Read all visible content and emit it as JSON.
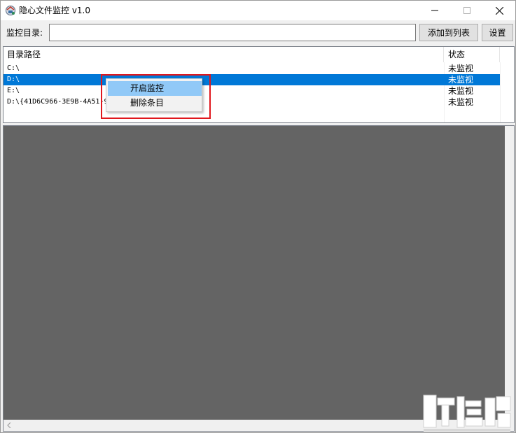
{
  "window": {
    "title": "隐心文件监控 v1.0"
  },
  "toolbar": {
    "dir_label": "监控目录:",
    "dir_value": "",
    "add_button": "添加到列表",
    "settings_button": "设置"
  },
  "list": {
    "columns": {
      "path": "目录路径",
      "status": "状态"
    },
    "rows": [
      {
        "path": "C:\\",
        "status": "未监视",
        "selected": false
      },
      {
        "path": "D:\\",
        "status": "未监视",
        "selected": true
      },
      {
        "path": "E:\\",
        "status": "未监视",
        "selected": false
      },
      {
        "path": "D:\\{41D6C966-3E9B-4A51-9",
        "status": "未监视",
        "selected": false
      }
    ]
  },
  "context_menu": {
    "items": [
      {
        "label": "开启监控",
        "highlighted": true
      },
      {
        "label": "删除条目",
        "highlighted": false
      }
    ],
    "annotation_color": "#e0171d"
  },
  "colors": {
    "selection": "#0078d7",
    "menu_hover": "#91c9f7",
    "log_background": "#646464"
  },
  "icons": {
    "app": "app-logo-icon",
    "minimize": "minimize-icon",
    "maximize": "maximize-icon",
    "close": "close-icon",
    "scroll_left": "chevron-left-icon"
  }
}
